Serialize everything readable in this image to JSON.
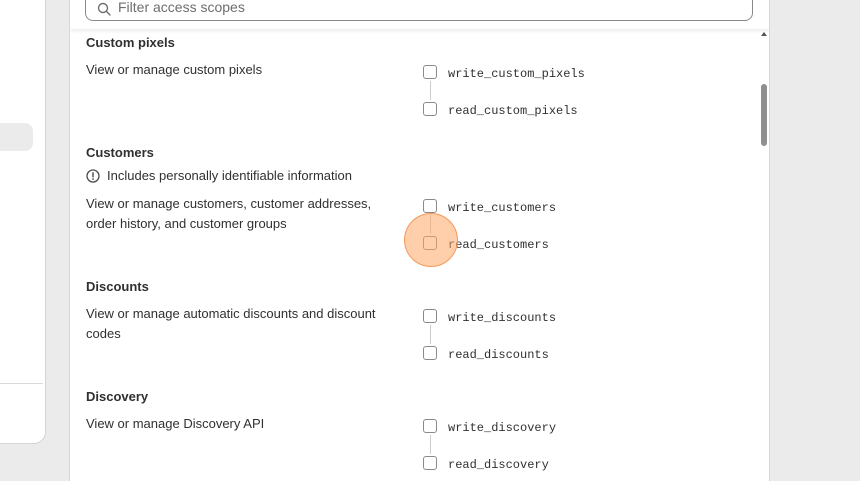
{
  "search": {
    "placeholder": "Filter access scopes"
  },
  "sections": [
    {
      "title": "Custom pixels",
      "description": "View or manage custom pixels",
      "scopes": [
        "write_custom_pixels",
        "read_custom_pixels"
      ]
    },
    {
      "title": "Customers",
      "note": "Includes personally identifiable information",
      "description_lines": [
        "View or manage customers, customer addresses,",
        "order history, and customer groups"
      ],
      "scopes": [
        "write_customers",
        "read_customers"
      ]
    },
    {
      "title": "Discounts",
      "description_lines": [
        "View or manage automatic discounts and discount",
        "codes"
      ],
      "scopes": [
        "write_discounts",
        "read_discounts"
      ]
    },
    {
      "title": "Discovery",
      "description": "View or manage Discovery API",
      "scopes": [
        "write_discovery",
        "read_discovery"
      ]
    }
  ],
  "colors": {
    "click_highlight": "#ffa564",
    "border": "#8a8a8a"
  }
}
